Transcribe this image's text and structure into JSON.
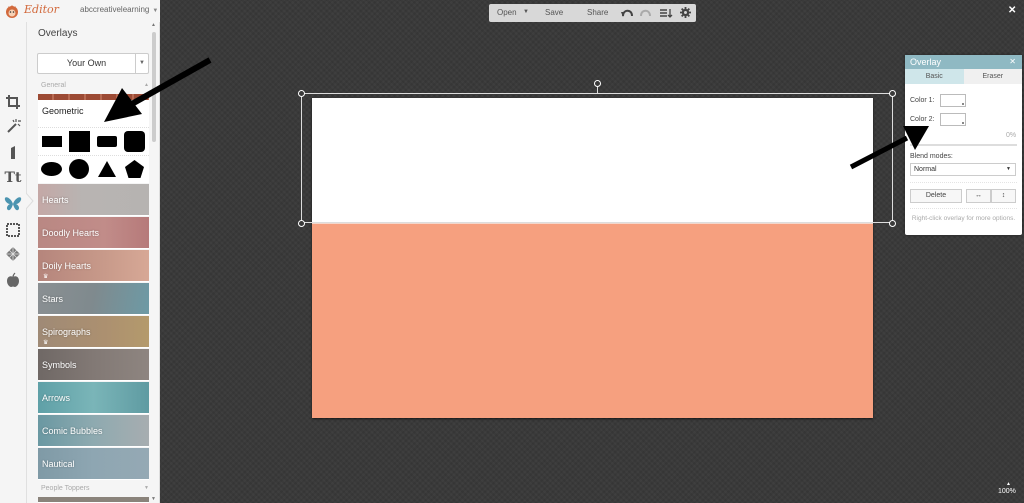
{
  "app": {
    "logo_text": "Editor",
    "account": "abccreativelearning",
    "close_icon": "close-icon"
  },
  "toolbar": {
    "open": "Open",
    "save": "Save",
    "share": "Share",
    "icons": [
      "undo-icon",
      "redo-icon",
      "layers-icon",
      "gear-icon"
    ]
  },
  "sidebar": {
    "tools": [
      "crop-icon",
      "magic-wand-icon",
      "lipstick-icon",
      "text-icon",
      "butterfly-icon",
      "frame-icon",
      "texture-icon",
      "apple-icon"
    ],
    "active_tool": "butterfly-icon",
    "title": "Overlays",
    "source_select": "Your Own",
    "groups": [
      {
        "header": "General",
        "items": [
          {
            "label": "Geometric",
            "expanded": true
          },
          {
            "label": "Hearts",
            "color": "#b9a9a6",
            "premium": false
          },
          {
            "label": "Doodly Hearts",
            "color": "#c28a86",
            "premium": false
          },
          {
            "label": "Doily Hearts",
            "color": "#c69487",
            "premium": true
          },
          {
            "label": "Stars",
            "color": "#8c9599",
            "premium": false
          },
          {
            "label": "Spirographs",
            "color": "#a5896b",
            "premium": true
          },
          {
            "label": "Symbols",
            "color": "#7e7673",
            "premium": false
          },
          {
            "label": "Arrows",
            "color": "#6aa7ad",
            "premium": false
          },
          {
            "label": "Comic Bubbles",
            "color": "#7ea3ab",
            "premium": false
          },
          {
            "label": "Nautical",
            "color": "#8ea6b2",
            "premium": false
          }
        ]
      },
      {
        "header": "People Toppers",
        "items": []
      }
    ],
    "geometric_shapes": [
      "rectangle-wide",
      "square",
      "rounded-rectangle",
      "rounded-square",
      "ellipse",
      "circle",
      "triangle",
      "pentagon"
    ]
  },
  "canvas": {
    "photo_color": "#f6a07f",
    "overlay_color": "#ffffff",
    "zoom": "100%"
  },
  "overlay_panel": {
    "title": "Overlay",
    "tabs": [
      "Basic",
      "Eraser"
    ],
    "active_tab": "Basic",
    "color1_label": "Color 1:",
    "color2_label": "Color 2:",
    "color1_value": "#ffffff",
    "color2_value": "#ffffff",
    "fade_value": "0%",
    "blend_label": "Blend modes:",
    "blend_value": "Normal",
    "delete": "Delete",
    "flip_h_icon": "flip-horizontal-icon",
    "flip_v_icon": "flip-vertical-icon",
    "hint": "Right-click overlay for more options."
  },
  "annotations": [
    "arrow-to-geometric",
    "arrow-to-color-2"
  ]
}
